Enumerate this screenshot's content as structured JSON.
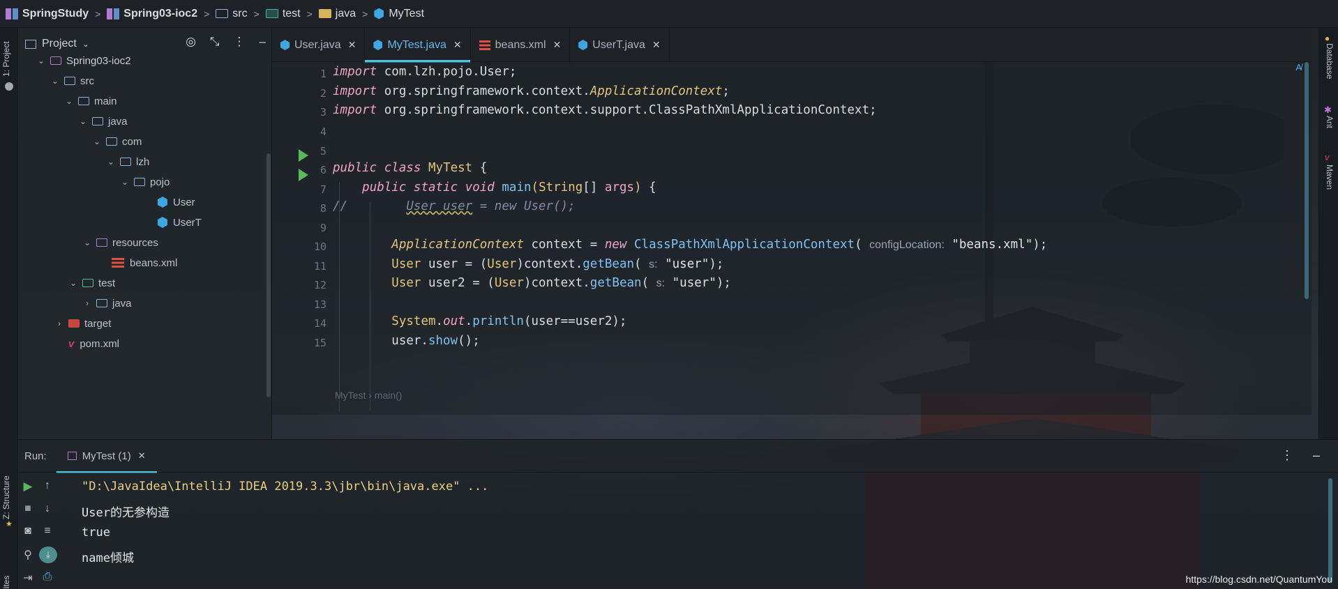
{
  "breadcrumb": [
    {
      "label": "SpringStudy",
      "bold": true,
      "icon": "module-icon"
    },
    {
      "label": "Spring03-ioc2",
      "bold": true,
      "icon": "module-icon"
    },
    {
      "label": "src",
      "bold": false,
      "icon": "source-folder-icon"
    },
    {
      "label": "test",
      "bold": false,
      "icon": "test-folder-icon"
    },
    {
      "label": "java",
      "bold": false,
      "icon": "folder-icon"
    },
    {
      "label": "MyTest",
      "bold": false,
      "icon": "class-icon"
    }
  ],
  "left_strip": {
    "project_label": "1: Project",
    "structure_label": "Z: Structure",
    "favorites_label": "Favorites"
  },
  "right_strip": {
    "database": "Database",
    "ant": "Ant",
    "maven": "Maven"
  },
  "project_panel": {
    "title": "Project",
    "tree": [
      {
        "label": "Spring03-ioc2",
        "type": "module"
      },
      {
        "label": "src",
        "type": "src"
      },
      {
        "label": "main",
        "type": "folder"
      },
      {
        "label": "java",
        "type": "source"
      },
      {
        "label": "com",
        "type": "package"
      },
      {
        "label": "lzh",
        "type": "package"
      },
      {
        "label": "pojo",
        "type": "package"
      },
      {
        "label": "User",
        "type": "class"
      },
      {
        "label": "UserT",
        "type": "class"
      },
      {
        "label": "resources",
        "type": "resources"
      },
      {
        "label": "beans.xml",
        "type": "xml"
      },
      {
        "label": "test",
        "type": "test"
      },
      {
        "label": "java",
        "type": "source"
      },
      {
        "label": "target",
        "type": "target"
      },
      {
        "label": "pom.xml",
        "type": "maven"
      }
    ]
  },
  "tabs": [
    {
      "label": "User.java",
      "active": false,
      "icon": "java-class-icon"
    },
    {
      "label": "MyTest.java",
      "active": true,
      "icon": "java-class-icon"
    },
    {
      "label": "beans.xml",
      "active": false,
      "icon": "xml-icon"
    },
    {
      "label": "UserT.java",
      "active": false,
      "icon": "java-class-icon"
    }
  ],
  "editor": {
    "line_numbers": [
      "1",
      "2",
      "3",
      "4",
      "5",
      "6",
      "7",
      "8",
      "9",
      "10",
      "11",
      "12",
      "13",
      "14",
      "15"
    ],
    "hints": {
      "config_location": "configLocation:",
      "s1": "s:",
      "s2": "s:"
    },
    "strings": {
      "beans": "\"beans.xml\"",
      "user1": "\"user\"",
      "user2": "\"user\""
    },
    "breadcrumb": [
      "MyTest",
      "main()"
    ]
  },
  "run_panel": {
    "label": "Run:",
    "tab_label": "MyTest (1)",
    "output": [
      {
        "text": "\"D:\\JavaIdea\\IntelliJ IDEA 2019.3.3\\jbr\\bin\\java.exe\" ...",
        "color": "#e7d279"
      },
      {
        "text": "User的无参构造",
        "color": "#e3e8ee"
      },
      {
        "text": "true",
        "color": "#e3e8ee"
      },
      {
        "text": "name倾城",
        "color": "#e3e8ee"
      }
    ]
  },
  "watermark": "https://blog.csdn.net/QuantumYou",
  "colors": {
    "accent": "#4fc3d8",
    "keyword": "#f0a2c8",
    "class": "#e3c57a",
    "method": "#7fc1f0",
    "run_green": "#59b85c"
  }
}
